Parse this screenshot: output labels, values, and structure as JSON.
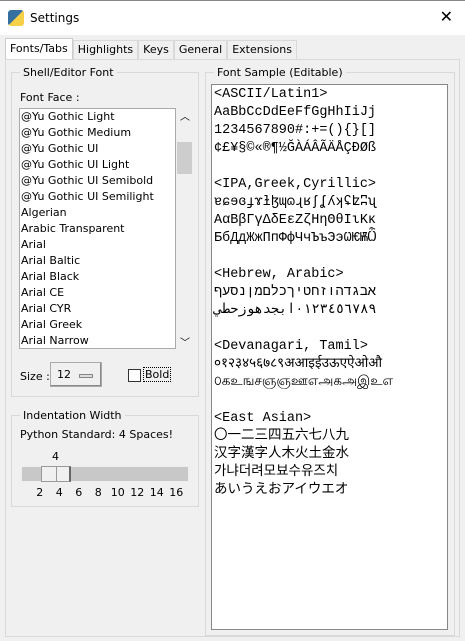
{
  "window": {
    "title": "Settings",
    "icon": "python-idle-icon",
    "close": "✕"
  },
  "tabs": [
    {
      "label": "Fonts/Tabs",
      "active": true
    },
    {
      "label": "Highlights"
    },
    {
      "label": "Keys"
    },
    {
      "label": "General"
    },
    {
      "label": "Extensions"
    }
  ],
  "font_panel": {
    "legend": "Shell/Editor Font",
    "font_face_label": "Font Face :",
    "fonts": [
      "@Yu Gothic Light",
      "@Yu Gothic Medium",
      "@Yu Gothic UI",
      "@Yu Gothic UI Light",
      "@Yu Gothic UI Semibold",
      "@Yu Gothic UI Semilight",
      "Algerian",
      "Arabic Transparent",
      "Arial",
      "Arial Baltic",
      "Arial Black",
      "Arial CE",
      "Arial CYR",
      "Arial Greek",
      "Arial Narrow"
    ],
    "size_label": "Size :",
    "size_value": "12",
    "bold_label": "Bold",
    "bold_checked": false
  },
  "indent_panel": {
    "legend": "Indentation Width",
    "note": "Python Standard: 4 Spaces!",
    "value": "4",
    "ticks": [
      "2",
      "4",
      "6",
      "8",
      "10",
      "12",
      "14",
      "16"
    ]
  },
  "sample_panel": {
    "legend": "Font Sample (Editable)",
    "lines": [
      "<ASCII/Latin1>",
      "AaBbCcDdEeFfGgHhIiJj",
      "1234567890#:+=(){}[]",
      "¢£¥§©«®¶½ĞÀÁÂÃÄÅÇÐØß",
      "",
      "<IPA,Greek,Cyrillic>",
      "ɐɕɘɞɟɤɫɮɰɷɻʁʃʆʎʞʢʫʭʯ",
      "ΑαΒβΓγΔδΕεΖζΗηΘθΙιΚκ",
      "БбДдЖжПпФфЧчЪъЭэѠѤѬѼ",
      "",
      "<Hebrew, Arabic>",
      "אבגדהוזחטיךכלםמןנסעף",
      "٠١٢٣٤٥٦٧٨٩ابجدهوزحطي",
      "",
      "<Devanagari, Tamil>",
      "०१२३४५६७८९अआइईउऊएऐओऔ",
      "௦கஉஙசஞஞஊஎஅகஅஇஉஎ",
      "",
      "<East Asian>",
      "〇一二三四五六七八九",
      "汉字漢字人木火土金水",
      "가냐더려모뵤수유즈치",
      "あいうえおアイウエオ"
    ]
  }
}
